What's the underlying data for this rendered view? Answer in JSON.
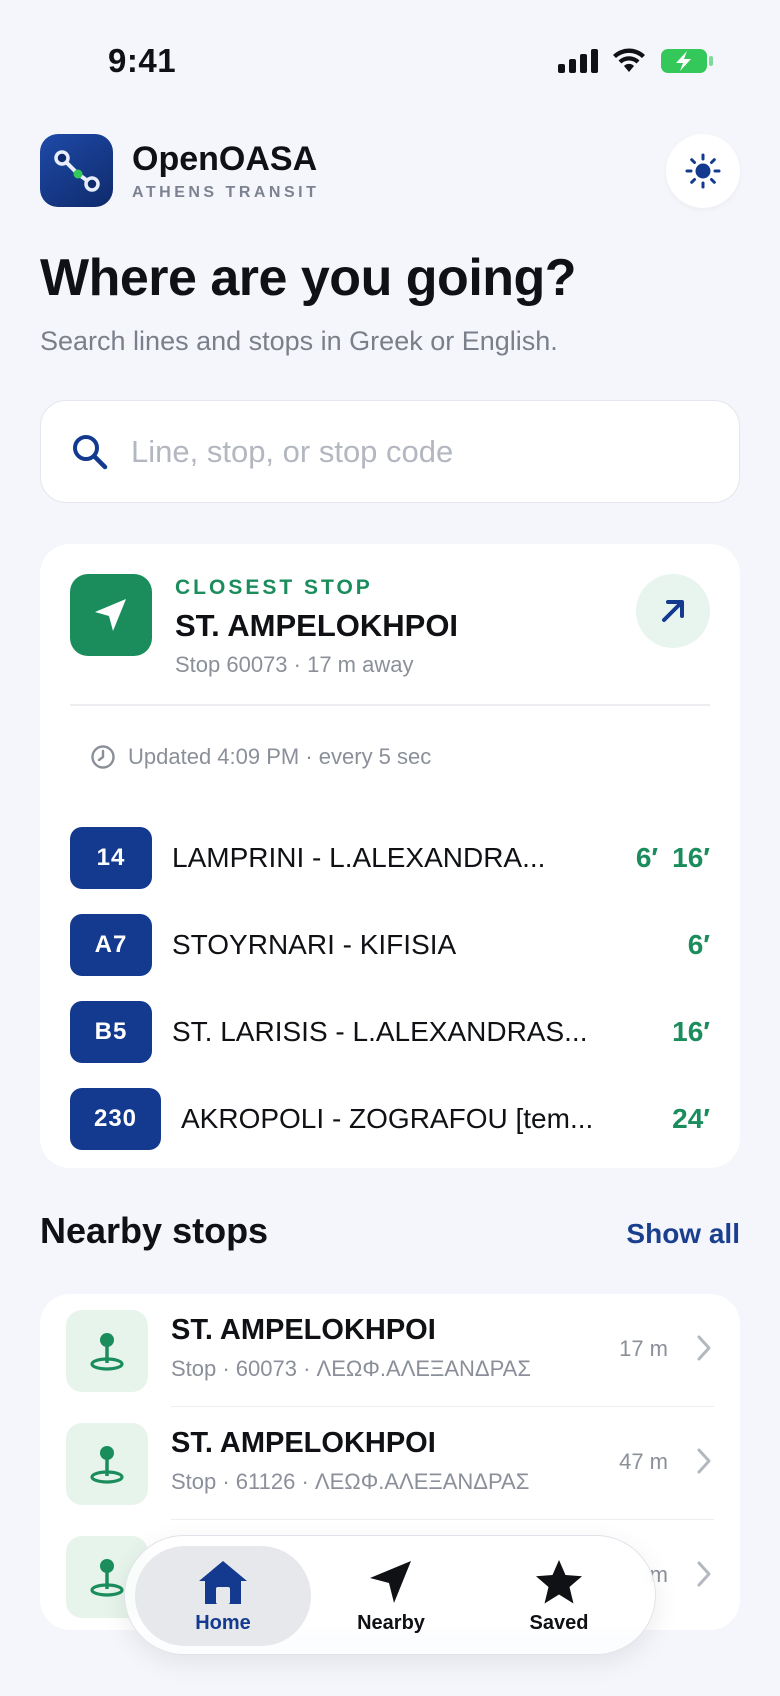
{
  "status_bar": {
    "time": "9:41"
  },
  "app": {
    "name": "OpenOASA",
    "subtitle": "ATHENS TRANSIT"
  },
  "hero": {
    "title": "Where are you going?",
    "subtitle": "Search lines and stops in Greek or English."
  },
  "search": {
    "placeholder": "Line, stop, or stop code",
    "value": ""
  },
  "closest_stop": {
    "label": "CLOSEST STOP",
    "name": "ST. AMPELOKHPOI",
    "meta": "Stop 60073 · 17 m away",
    "updated": "Updated 4:09 PM · every 5 sec",
    "arrivals": [
      {
        "line": "14",
        "route": "LAMPRINI  - L.ALEXANDRA...",
        "times": [
          "6′",
          "16′"
        ]
      },
      {
        "line": "A7",
        "route": "STOYRNARI - KIFISIA",
        "times": [
          "6′"
        ]
      },
      {
        "line": "B5",
        "route": "ST. LARISIS -  L.ALEXANDRAS...",
        "times": [
          "16′"
        ]
      },
      {
        "line": "230",
        "route": "AKROPOLI - ZOGRAFOU [tem...",
        "times": [
          "24′"
        ]
      }
    ]
  },
  "nearby": {
    "title": "Nearby stops",
    "show_all": "Show all",
    "stops": [
      {
        "name": "ST. AMPELOKHPOI",
        "meta": "Stop · 60073 · ΛΕΩΦ.ΑΛΕΞΑΝΔΡΑΣ",
        "distance": "17 m"
      },
      {
        "name": "ST. AMPELOKHPOI",
        "meta": "Stop · 61126 · ΛΕΩΦ.ΑΛΕΞΑΝΔΡΑΣ",
        "distance": "47 m"
      },
      {
        "name": "",
        "meta": "",
        "distance": "m"
      }
    ]
  },
  "tabs": [
    {
      "label": "Home",
      "active": true
    },
    {
      "label": "Nearby",
      "active": false
    },
    {
      "label": "Saved",
      "active": false
    }
  ],
  "colors": {
    "accent_green": "#1b8d5c",
    "line_blue": "#133a8e",
    "background": "#f4f6fb"
  }
}
